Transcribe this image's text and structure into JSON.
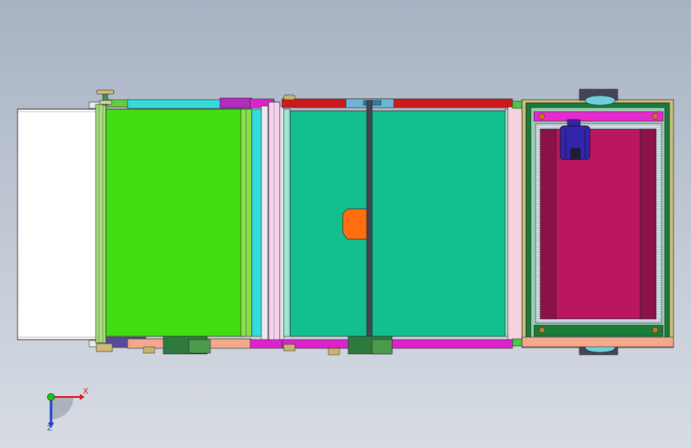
{
  "viewport": {
    "background_top": "#a7b2c3",
    "background_bottom": "#d7dce4"
  },
  "model": {
    "colors": {
      "feed_tray": "#ffffff",
      "green_belt": "#44dd11",
      "teal_belt": "#12c08d",
      "cyan_rail": "#33dddd",
      "red_rail": "#cc1a1a",
      "magenta_rail": "#dd22cc",
      "pink_panel": "#f7d2dd",
      "salmon_rail": "#f4a88c",
      "orange_block": "#ff6f10",
      "frame_green": "#1a7a3a",
      "frame_olive": "#c9c27a",
      "chamber_crimson": "#bb1660",
      "chamber_dark": "#8a1248",
      "motor_blue": "#3325aa",
      "dark_bar": "#444452"
    }
  },
  "triad": {
    "x_label": "X",
    "z_label": "Z",
    "x_color": "#dd1a1a",
    "y_color": "#22bb22",
    "z_color": "#2244cc"
  }
}
